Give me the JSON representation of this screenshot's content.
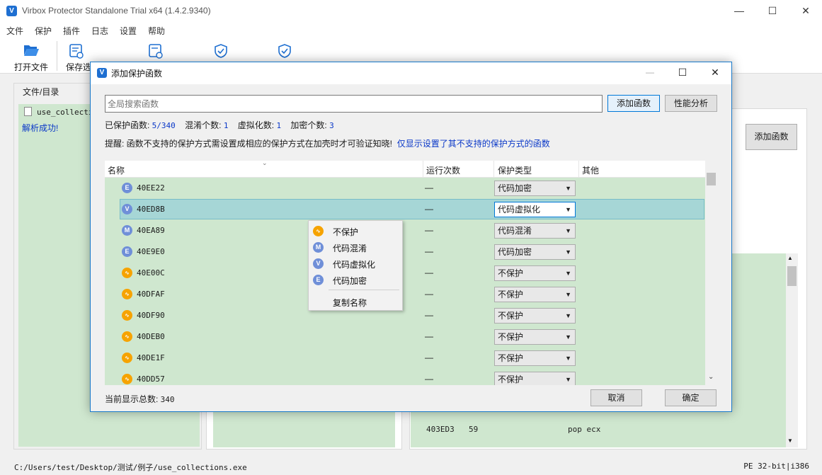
{
  "app": {
    "title": "Virbox Protector Standalone Trial x64  (1.4.2.9340)",
    "logo_letter": "V"
  },
  "menu": [
    "文件",
    "保护",
    "插件",
    "日志",
    "设置",
    "帮助"
  ],
  "toolbar": {
    "open_label": "打开文件",
    "save_label": "保存选"
  },
  "left": {
    "group_title": "文件/目录",
    "file_name": "use_collections.exe",
    "status": "解析成功!"
  },
  "right": {
    "add_button": "添加函数",
    "asm_rows": [
      {
        "addr": "403ED3",
        "bytes": "59",
        "instr": "pop ecx"
      }
    ]
  },
  "statusbar": {
    "path": "C:/Users/test/Desktop/测试/例子/use_collections.exe",
    "arch": "PE 32-bit|i386"
  },
  "dialog": {
    "title": "添加保护函数",
    "search_placeholder": "全局搜索函数",
    "add_button": "添加函数",
    "perf_button": "性能分析",
    "stats": {
      "protected_label": "已保护函数: ",
      "protected_value": "5/340",
      "obf_label": "混淆个数: ",
      "obf_value": "1",
      "virt_label": "虚拟化数: ",
      "virt_value": "1",
      "enc_label": "加密个数: ",
      "enc_value": "3"
    },
    "hint": "提醒: 函数不支持的保护方式需设置成相应的保护方式在加壳时才可验证知晓!",
    "hint_link": "仅显示设置了其不支持的保护方式的函数",
    "columns": {
      "name": "名称",
      "runs": "运行次数",
      "type": "保护类型",
      "other": "其他"
    },
    "rows": [
      {
        "badge": "E",
        "name": "40EE22",
        "runs": "—",
        "type": "代码加密"
      },
      {
        "badge": "V",
        "name": "40ED8B",
        "runs": "—",
        "type": "代码虚拟化",
        "selected": true
      },
      {
        "badge": "M",
        "name": "40EA89",
        "runs": "—",
        "type": "代码混淆"
      },
      {
        "badge": "E",
        "name": "40E9E0",
        "runs": "—",
        "type": "代码加密"
      },
      {
        "badge": "N",
        "name": "40E00C",
        "runs": "—",
        "type": "不保护"
      },
      {
        "badge": "N",
        "name": "40DFAF",
        "runs": "—",
        "type": "不保护"
      },
      {
        "badge": "N",
        "name": "40DF90",
        "runs": "—",
        "type": "不保护"
      },
      {
        "badge": "N",
        "name": "40DEB0",
        "runs": "—",
        "type": "不保护"
      },
      {
        "badge": "N",
        "name": "40DE1F",
        "runs": "—",
        "type": "不保护"
      },
      {
        "badge": "N",
        "name": "40DD57",
        "runs": "—",
        "type": "不保护"
      }
    ],
    "total_label": "当前显示总数: ",
    "total_value": "340",
    "cancel_button": "取消",
    "ok_button": "确定"
  },
  "context_menu": {
    "items": [
      {
        "icon": "N",
        "label": "不保护"
      },
      {
        "icon": "M",
        "label": "代码混淆"
      },
      {
        "icon": "V",
        "label": "代码虚拟化"
      },
      {
        "icon": "E",
        "label": "代码加密"
      }
    ],
    "copy_label": "复制名称"
  },
  "colors": {
    "accent": "#1e6fd1",
    "row_green": "#cfe7cf",
    "row_selected": "#a6d6d6",
    "badge_blue": "#6f8fd8",
    "badge_orange": "#f6a300",
    "link": "#0a38c8"
  }
}
